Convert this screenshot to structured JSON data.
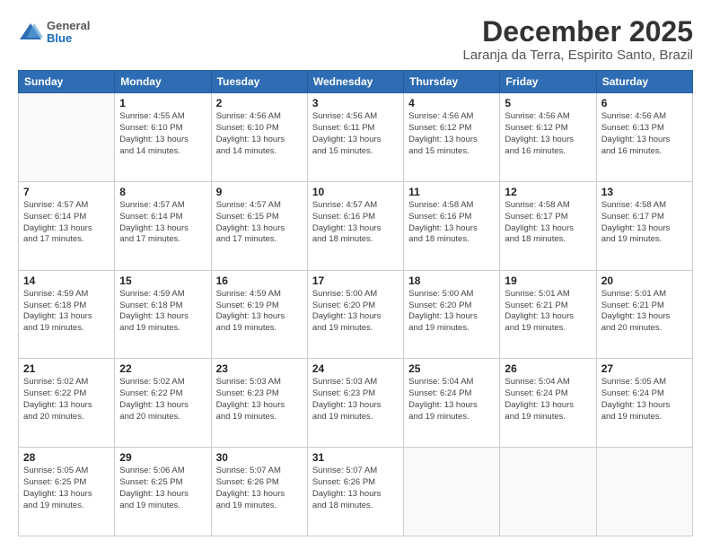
{
  "header": {
    "logo": {
      "general": "General",
      "blue": "Blue"
    },
    "title": "December 2025",
    "subtitle": "Laranja da Terra, Espirito Santo, Brazil"
  },
  "calendar": {
    "headers": [
      "Sunday",
      "Monday",
      "Tuesday",
      "Wednesday",
      "Thursday",
      "Friday",
      "Saturday"
    ],
    "weeks": [
      [
        {
          "day": "",
          "info": ""
        },
        {
          "day": "1",
          "info": "Sunrise: 4:55 AM\nSunset: 6:10 PM\nDaylight: 13 hours\nand 14 minutes."
        },
        {
          "day": "2",
          "info": "Sunrise: 4:56 AM\nSunset: 6:10 PM\nDaylight: 13 hours\nand 14 minutes."
        },
        {
          "day": "3",
          "info": "Sunrise: 4:56 AM\nSunset: 6:11 PM\nDaylight: 13 hours\nand 15 minutes."
        },
        {
          "day": "4",
          "info": "Sunrise: 4:56 AM\nSunset: 6:12 PM\nDaylight: 13 hours\nand 15 minutes."
        },
        {
          "day": "5",
          "info": "Sunrise: 4:56 AM\nSunset: 6:12 PM\nDaylight: 13 hours\nand 16 minutes."
        },
        {
          "day": "6",
          "info": "Sunrise: 4:56 AM\nSunset: 6:13 PM\nDaylight: 13 hours\nand 16 minutes."
        }
      ],
      [
        {
          "day": "7",
          "info": "Sunrise: 4:57 AM\nSunset: 6:14 PM\nDaylight: 13 hours\nand 17 minutes."
        },
        {
          "day": "8",
          "info": "Sunrise: 4:57 AM\nSunset: 6:14 PM\nDaylight: 13 hours\nand 17 minutes."
        },
        {
          "day": "9",
          "info": "Sunrise: 4:57 AM\nSunset: 6:15 PM\nDaylight: 13 hours\nand 17 minutes."
        },
        {
          "day": "10",
          "info": "Sunrise: 4:57 AM\nSunset: 6:16 PM\nDaylight: 13 hours\nand 18 minutes."
        },
        {
          "day": "11",
          "info": "Sunrise: 4:58 AM\nSunset: 6:16 PM\nDaylight: 13 hours\nand 18 minutes."
        },
        {
          "day": "12",
          "info": "Sunrise: 4:58 AM\nSunset: 6:17 PM\nDaylight: 13 hours\nand 18 minutes."
        },
        {
          "day": "13",
          "info": "Sunrise: 4:58 AM\nSunset: 6:17 PM\nDaylight: 13 hours\nand 19 minutes."
        }
      ],
      [
        {
          "day": "14",
          "info": "Sunrise: 4:59 AM\nSunset: 6:18 PM\nDaylight: 13 hours\nand 19 minutes."
        },
        {
          "day": "15",
          "info": "Sunrise: 4:59 AM\nSunset: 6:18 PM\nDaylight: 13 hours\nand 19 minutes."
        },
        {
          "day": "16",
          "info": "Sunrise: 4:59 AM\nSunset: 6:19 PM\nDaylight: 13 hours\nand 19 minutes."
        },
        {
          "day": "17",
          "info": "Sunrise: 5:00 AM\nSunset: 6:20 PM\nDaylight: 13 hours\nand 19 minutes."
        },
        {
          "day": "18",
          "info": "Sunrise: 5:00 AM\nSunset: 6:20 PM\nDaylight: 13 hours\nand 19 minutes."
        },
        {
          "day": "19",
          "info": "Sunrise: 5:01 AM\nSunset: 6:21 PM\nDaylight: 13 hours\nand 19 minutes."
        },
        {
          "day": "20",
          "info": "Sunrise: 5:01 AM\nSunset: 6:21 PM\nDaylight: 13 hours\nand 20 minutes."
        }
      ],
      [
        {
          "day": "21",
          "info": "Sunrise: 5:02 AM\nSunset: 6:22 PM\nDaylight: 13 hours\nand 20 minutes."
        },
        {
          "day": "22",
          "info": "Sunrise: 5:02 AM\nSunset: 6:22 PM\nDaylight: 13 hours\nand 20 minutes."
        },
        {
          "day": "23",
          "info": "Sunrise: 5:03 AM\nSunset: 6:23 PM\nDaylight: 13 hours\nand 19 minutes."
        },
        {
          "day": "24",
          "info": "Sunrise: 5:03 AM\nSunset: 6:23 PM\nDaylight: 13 hours\nand 19 minutes."
        },
        {
          "day": "25",
          "info": "Sunrise: 5:04 AM\nSunset: 6:24 PM\nDaylight: 13 hours\nand 19 minutes."
        },
        {
          "day": "26",
          "info": "Sunrise: 5:04 AM\nSunset: 6:24 PM\nDaylight: 13 hours\nand 19 minutes."
        },
        {
          "day": "27",
          "info": "Sunrise: 5:05 AM\nSunset: 6:24 PM\nDaylight: 13 hours\nand 19 minutes."
        }
      ],
      [
        {
          "day": "28",
          "info": "Sunrise: 5:05 AM\nSunset: 6:25 PM\nDaylight: 13 hours\nand 19 minutes."
        },
        {
          "day": "29",
          "info": "Sunrise: 5:06 AM\nSunset: 6:25 PM\nDaylight: 13 hours\nand 19 minutes."
        },
        {
          "day": "30",
          "info": "Sunrise: 5:07 AM\nSunset: 6:26 PM\nDaylight: 13 hours\nand 19 minutes."
        },
        {
          "day": "31",
          "info": "Sunrise: 5:07 AM\nSunset: 6:26 PM\nDaylight: 13 hours\nand 18 minutes."
        },
        {
          "day": "",
          "info": ""
        },
        {
          "day": "",
          "info": ""
        },
        {
          "day": "",
          "info": ""
        }
      ]
    ]
  }
}
